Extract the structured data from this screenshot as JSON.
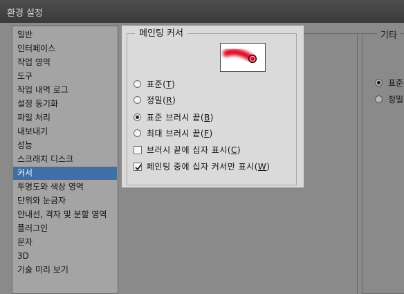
{
  "window": {
    "title": "환경 설정"
  },
  "sidebar": {
    "selected_index": 10,
    "items": [
      {
        "label": "일반"
      },
      {
        "label": "인터페이스"
      },
      {
        "label": "작업 영역"
      },
      {
        "label": "도구"
      },
      {
        "label": "작업 내역 로그"
      },
      {
        "label": "설정 동기화"
      },
      {
        "label": "파일 처리"
      },
      {
        "label": "내보내기"
      },
      {
        "label": "성능"
      },
      {
        "label": "스크래치 디스크"
      },
      {
        "label": "커서"
      },
      {
        "label": "투명도와 색상 영역"
      },
      {
        "label": "단위와 눈금자"
      },
      {
        "label": "안내선, 격자 및 분할 영역"
      },
      {
        "label": "플러그인"
      },
      {
        "label": "문자"
      },
      {
        "label": "3D"
      },
      {
        "label": "기술 미리 보기"
      }
    ]
  },
  "painting_cursors": {
    "legend": "페인팅 커서",
    "preview_brush_color": "#e0102a",
    "options": [
      {
        "type": "radio",
        "label": "표준(",
        "key": "T",
        "checked": false
      },
      {
        "type": "radio",
        "label": "정밀(",
        "key": "R",
        "checked": false
      },
      {
        "type": "radio",
        "label": "표준 브러시 끝(",
        "key": "B",
        "checked": true
      },
      {
        "type": "radio",
        "label": "최대 브러시 끝(",
        "key": "F",
        "checked": false
      },
      {
        "type": "checkbox",
        "label": "브러시 끝에 십자 표시(",
        "key": "C",
        "checked": false
      },
      {
        "type": "checkbox",
        "label": "페인팅 중에 십자 커서만 표시(",
        "key": "W",
        "checked": true
      }
    ]
  },
  "other_cursors": {
    "legend": "기타",
    "options": [
      {
        "label": "표준",
        "checked": true
      },
      {
        "label": "정밀",
        "checked": false
      }
    ]
  },
  "colors": {
    "selection": "#3e6fa6",
    "panel_highlight": "#dadada",
    "dialog_bg": "#8a8a8a"
  }
}
